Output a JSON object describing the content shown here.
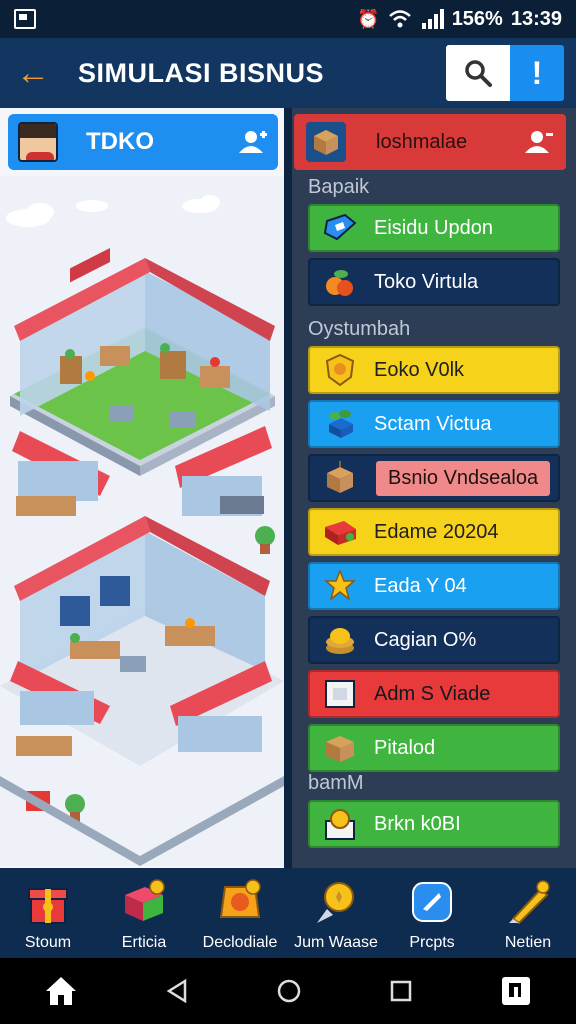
{
  "status_bar": {
    "battery": "156%",
    "time": "13:39"
  },
  "app_bar": {
    "title": "SIMULASI BISNUS"
  },
  "store": {
    "name": "TDKO"
  },
  "right_panel": {
    "header_title": "loshmalae",
    "sections": [
      {
        "label": "Bapaik",
        "items": [
          {
            "label": "Eisidu Updon",
            "color": "#3fb53f"
          },
          {
            "label": "Toko Virtula",
            "color": "#13305a"
          }
        ]
      },
      {
        "label": "Oystumbah",
        "items": [
          {
            "label": "Eoko V0lk",
            "color": "#f6d21a"
          },
          {
            "label": "Sctam Victua",
            "color": "#1aa0f0"
          },
          {
            "label": "Bsnio Vndsealoa",
            "color": "#f08a8a"
          },
          {
            "label": "Edame 20204",
            "color": "#f6d21a"
          },
          {
            "label": "Eada Y 04",
            "color": "#1aa0f0"
          },
          {
            "label": "Cagian O%",
            "color": "#13305a"
          },
          {
            "label": "Adm S Viade",
            "color": "#e83a3a"
          },
          {
            "label": "Pitalod",
            "color": "#3fb53f"
          }
        ]
      },
      {
        "label": "bamM",
        "items": [
          {
            "label": "Brkn k0BI",
            "color": "#3fb53f"
          }
        ]
      }
    ]
  },
  "bottom_nav": [
    {
      "label": "Stoum",
      "icon": "gift-box-icon"
    },
    {
      "label": "Erticia",
      "icon": "chest-icon"
    },
    {
      "label": "Declodiale",
      "icon": "badge-icon"
    },
    {
      "label": "Jum Waase",
      "icon": "coin-pin-icon"
    },
    {
      "label": "Prcpts",
      "icon": "blue-shield-icon"
    },
    {
      "label": "Netien",
      "icon": "pencil-icon"
    }
  ]
}
